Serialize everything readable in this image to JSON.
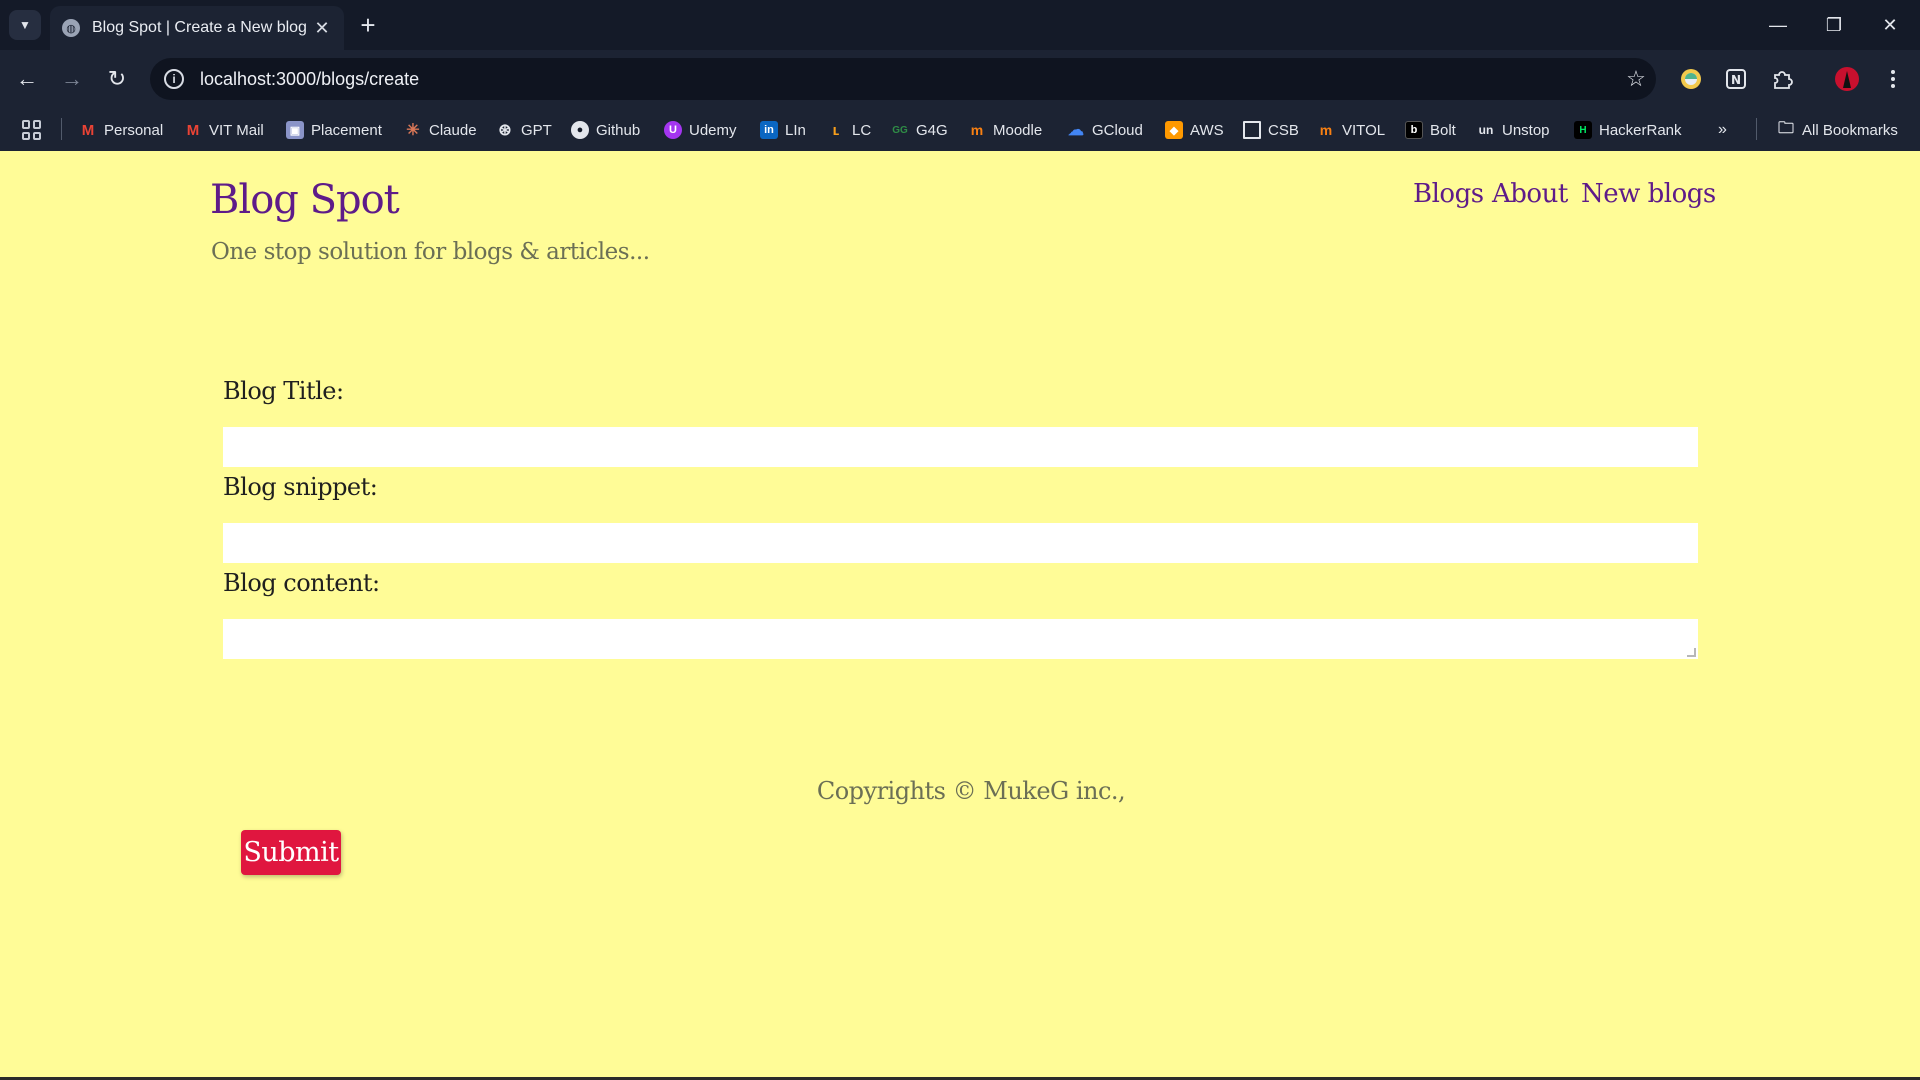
{
  "browser": {
    "tab_title": "Blog Spot | Create a New blog",
    "url": "localhost:3000/blogs/create",
    "bookmarks": [
      {
        "label": "Personal",
        "icon": "gmail-icon",
        "color": "#ea4335"
      },
      {
        "label": "VIT Mail",
        "icon": "gmail-icon",
        "color": "#ea4335"
      },
      {
        "label": "Placement",
        "icon": "placement-icon",
        "color": "#8a94c8"
      },
      {
        "label": "Claude",
        "icon": "claude-icon",
        "color": "#d97757"
      },
      {
        "label": "GPT",
        "icon": "openai-icon",
        "color": "#e3e6ec"
      },
      {
        "label": "Github",
        "icon": "github-icon",
        "color": "#e3e6ec"
      },
      {
        "label": "Udemy",
        "icon": "udemy-icon",
        "color": "#a435f0"
      },
      {
        "label": "LIn",
        "icon": "linkedin-icon",
        "color": "#0a66c2"
      },
      {
        "label": "LC",
        "icon": "leetcode-icon",
        "color": "#f89f1b"
      },
      {
        "label": "G4G",
        "icon": "geeksforgeeks-icon",
        "color": "#2f8d46"
      },
      {
        "label": "Moodle",
        "icon": "moodle-icon",
        "color": "#f98012"
      },
      {
        "label": "GCloud",
        "icon": "google-cloud-icon",
        "color": "#4285f4"
      },
      {
        "label": "AWS",
        "icon": "aws-icon",
        "color": "#ff9900"
      },
      {
        "label": "CSB",
        "icon": "codesandbox-icon",
        "color": "#e3e6ec"
      },
      {
        "label": "VITOL",
        "icon": "moodle-icon",
        "color": "#f98012"
      },
      {
        "label": "Bolt",
        "icon": "bolt-icon",
        "color": "#000000"
      },
      {
        "label": "Unstop",
        "icon": "unstop-icon",
        "color": "#1c4980"
      },
      {
        "label": "HackerRank",
        "icon": "hackerrank-icon",
        "color": "#00ea64"
      }
    ],
    "all_bookmarks_label": "All Bookmarks"
  },
  "site": {
    "title": "Blog Spot",
    "tagline": "One stop solution for blogs & articles...",
    "nav": [
      "Blogs",
      "About",
      "New blogs"
    ],
    "title_color": "#5e1b89",
    "background": "#fffc97"
  },
  "form": {
    "title_label": "Blog Title:",
    "title_value": "",
    "snippet_label": "Blog snippet:",
    "snippet_value": "",
    "content_label": "Blog content:",
    "content_value": "",
    "submit_label": "Submit",
    "submit_color": "#e0163f"
  },
  "footer": {
    "text": "Copyrights © MukeG inc.,"
  }
}
